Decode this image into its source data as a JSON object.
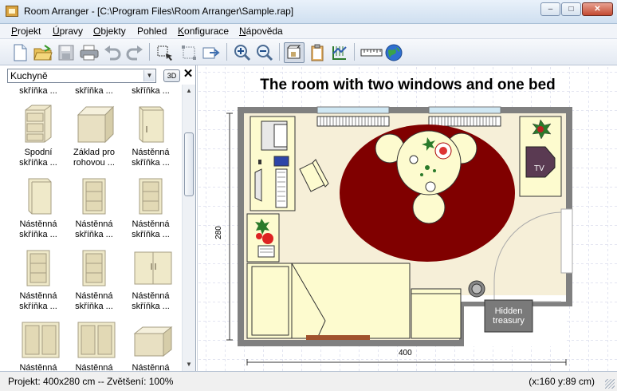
{
  "window": {
    "title": "Room Arranger - [C:\\Program Files\\Room Arranger\\Sample.rap]",
    "minimize_glyph": "–",
    "maximize_glyph": "□",
    "close_glyph": "✕"
  },
  "menu": [
    {
      "underline": "P",
      "rest": "rojekt"
    },
    {
      "underline": "Ú",
      "rest": "pravy"
    },
    {
      "underline": "O",
      "rest": "bjekty"
    },
    {
      "underline": "",
      "rest": "Pohled"
    },
    {
      "underline": "K",
      "rest": "onfigurace"
    },
    {
      "underline": "N",
      "rest": "ápověda"
    }
  ],
  "toolbar": {
    "icons": [
      "new-document-icon",
      "open-folder-icon",
      "save-disk-icon",
      "print-icon",
      "undo-icon",
      "redo-icon",
      "move-object-icon",
      "select-area-icon",
      "export-icon",
      "zoom-in-icon",
      "zoom-out-icon",
      "room-view-icon",
      "clipboard-icon",
      "walls-icon",
      "measure-ruler-icon",
      "globe-icon"
    ]
  },
  "library": {
    "category": "Kuchyně",
    "btn_3d": "3D",
    "close_glyph": "✕",
    "partial_row": [
      "skříňka ...",
      "skříňka ...",
      "skříňka ..."
    ],
    "items": [
      {
        "label": "Spodní\nskříňka ..."
      },
      {
        "label": "Základ pro\nrohovou ..."
      },
      {
        "label": "Nástěnná\nskříňka ..."
      },
      {
        "label": "Nástěnná\nskříňka ..."
      },
      {
        "label": "Nástěnná\nskříňka ..."
      },
      {
        "label": "Nástěnná\nskříňka ..."
      },
      {
        "label": "Nástěnná\nskříňka ..."
      },
      {
        "label": "Nástěnná\nskříňka ..."
      },
      {
        "label": "Nástěnná\nskříňka ..."
      },
      {
        "label": "Nástěnná"
      },
      {
        "label": "Nástěnná"
      },
      {
        "label": "Nástěnná"
      }
    ]
  },
  "plan": {
    "title": "The room with two windows and one bed",
    "dim_height": "280",
    "dim_width": "400",
    "tv_label": "TV",
    "hidden_label": "Hidden\ntreasury",
    "colors": {
      "wall": "#808080",
      "floor": "#f6efd8",
      "rug": "#800000",
      "furniture": "#fdfbcf",
      "hidden_box": "#7a7a7a"
    }
  },
  "status": {
    "left": "Projekt: 400x280 cm -- Zvětšení: 100%",
    "right": "(x:160 y:89 cm)"
  }
}
